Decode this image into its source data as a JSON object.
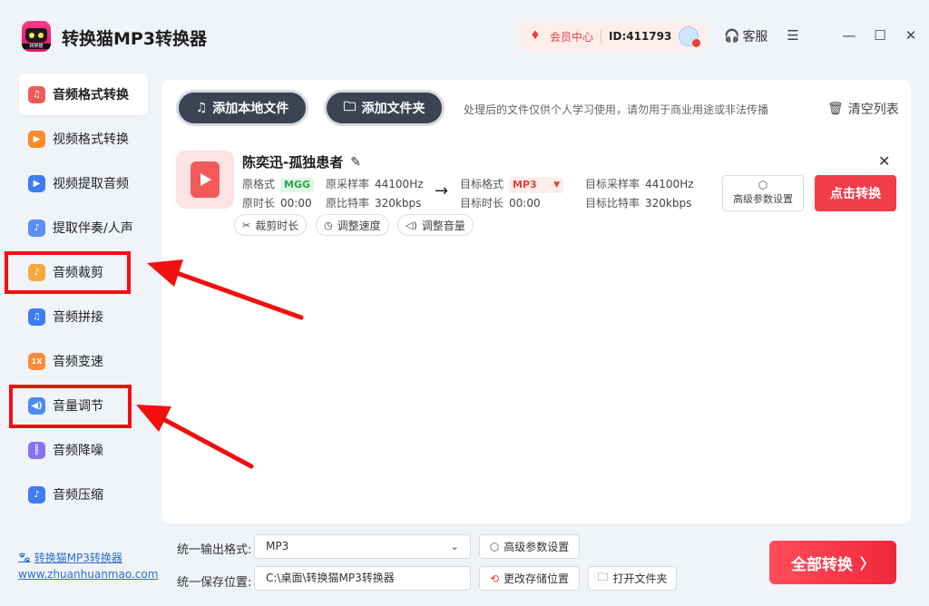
{
  "app": {
    "title": "转换猫MP3转换器",
    "logo_text": "转换猫"
  },
  "header": {
    "vip_label": "会员中心",
    "user_id": "ID:411793",
    "service_label": "客服",
    "icons": [
      "diamond-icon",
      "headset-icon",
      "menu-icon",
      "minimize-icon",
      "maximize-icon",
      "close-icon"
    ]
  },
  "sidebar": {
    "items": [
      {
        "label": "音频格式转换",
        "icon": "audio-convert-icon",
        "color": "#f05a5a"
      },
      {
        "label": "视频格式转换",
        "icon": "video-convert-icon",
        "color": "#ff8a2a"
      },
      {
        "label": "视频提取音频",
        "icon": "video-extract-icon",
        "color": "#3d7cf2"
      },
      {
        "label": "提取伴奏/人声",
        "icon": "vocal-extract-icon",
        "color": "#5b8ef7"
      },
      {
        "label": "音频裁剪",
        "icon": "audio-cut-icon",
        "color": "#f5a93a"
      },
      {
        "label": "音频拼接",
        "icon": "audio-merge-icon",
        "color": "#3d7cf2"
      },
      {
        "label": "音频变速",
        "icon": "audio-speed-icon",
        "color": "#ff8a3a",
        "glyph": "1X"
      },
      {
        "label": "音量调节",
        "icon": "volume-icon",
        "color": "#4c8bf5"
      },
      {
        "label": "音频降噪",
        "icon": "denoise-icon",
        "color": "#8a72f2"
      },
      {
        "label": "音频压缩",
        "icon": "audio-compress-icon",
        "color": "#3d7cf2"
      }
    ],
    "active_index": 0,
    "site_name": "转换猫MP3转换器",
    "site_url": "www.zhuanhuanmao.com"
  },
  "toolbar": {
    "add_file_label": "添加本地文件",
    "add_folder_label": "添加文件夹",
    "disclaimer": "处理后的文件仅供个人学习使用，请勿用于商业用途或非法传播",
    "clear_label": "清空列表"
  },
  "file": {
    "name": "陈奕迅-孤独患者",
    "orig_format_label": "原格式",
    "orig_format_value": "MGG",
    "orig_duration_label": "原时长",
    "orig_duration_value": "00:00",
    "orig_samplerate_label": "原采样率",
    "orig_samplerate_value": "44100Hz",
    "orig_bitrate_label": "原比特率",
    "orig_bitrate_value": "320kbps",
    "target_format_label": "目标格式",
    "target_format_value": "MP3",
    "target_duration_label": "目标时长",
    "target_duration_value": "00:00",
    "target_samplerate_label": "目标采样率",
    "target_samplerate_value": "44100Hz",
    "target_bitrate_label": "目标比特率",
    "target_bitrate_value": "320kbps",
    "adv_label": "高级参数设置",
    "convert_label": "点击转换",
    "tools": [
      "裁剪时长",
      "调整速度",
      "调整音量"
    ]
  },
  "bottom": {
    "output_format_label": "统一输出格式:",
    "output_format_value": "MP3",
    "adv_label": "高级参数设置",
    "save_path_label": "统一保存位置:",
    "save_path_value": "C:\\桌面\\转换猫MP3转换器",
    "change_path_label": "更改存储位置",
    "open_folder_label": "打开文件夹",
    "convert_all_label": "全部转换"
  },
  "annotations": {
    "highlight_color": "#f20f0f"
  }
}
